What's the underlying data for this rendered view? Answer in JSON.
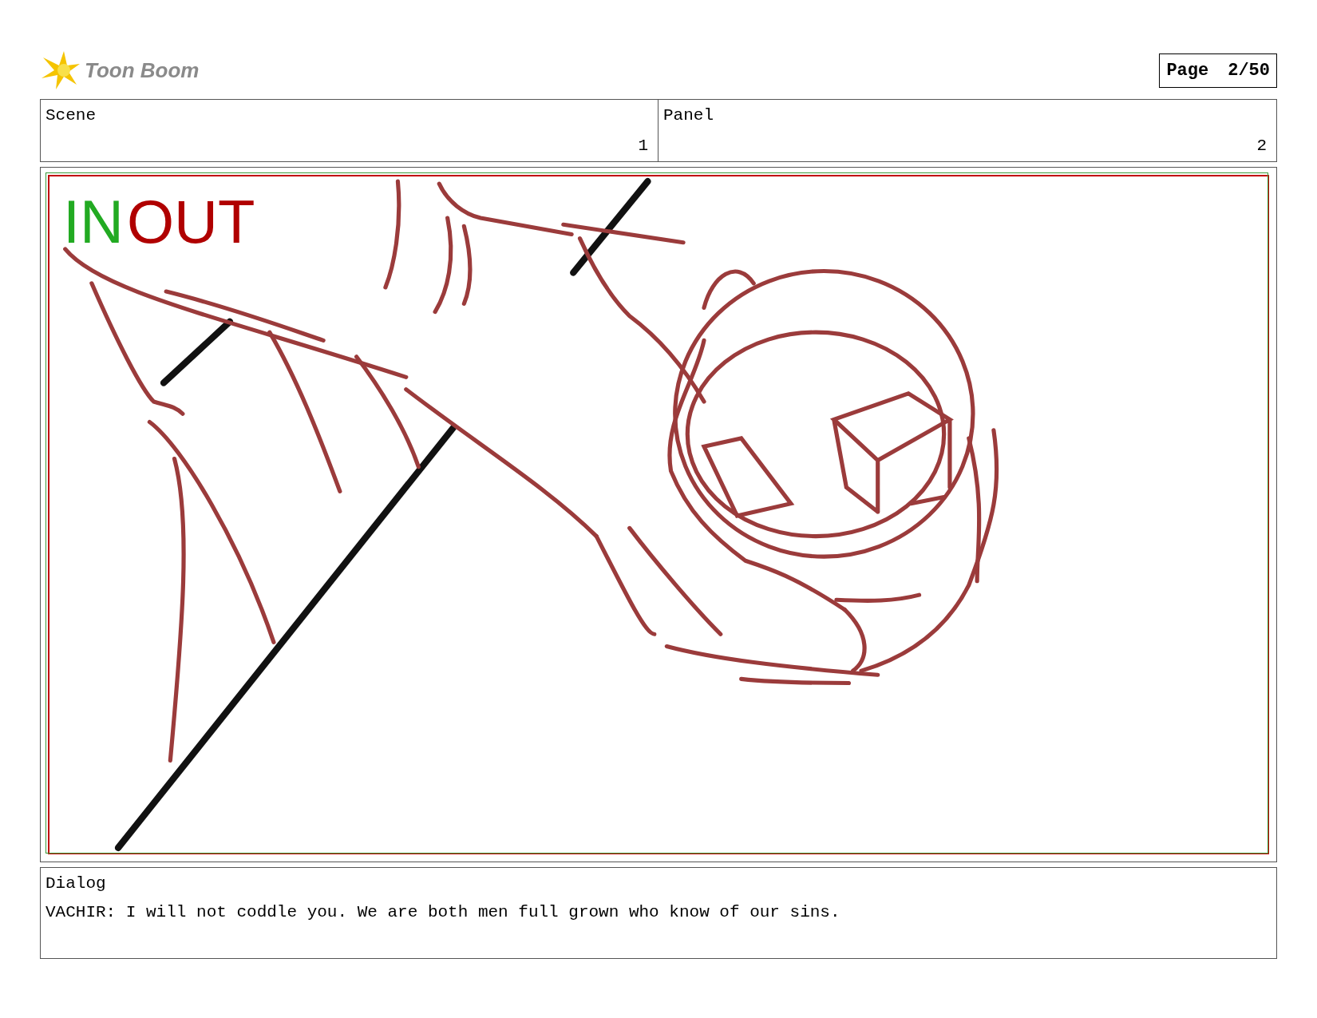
{
  "header": {
    "logo_text": "Toon Boom",
    "page_label": "Page",
    "page_number": "2/50"
  },
  "fields": [
    {
      "label": "Scene",
      "value": "1"
    },
    {
      "label": "Panel",
      "value": "2"
    }
  ],
  "panel": {
    "overlay_in": "IN",
    "overlay_out": "OUT"
  },
  "dialog": {
    "label": "Dialog",
    "text": "VACHIR: I will not coddle you. We are both men full grown who know of our sins."
  }
}
